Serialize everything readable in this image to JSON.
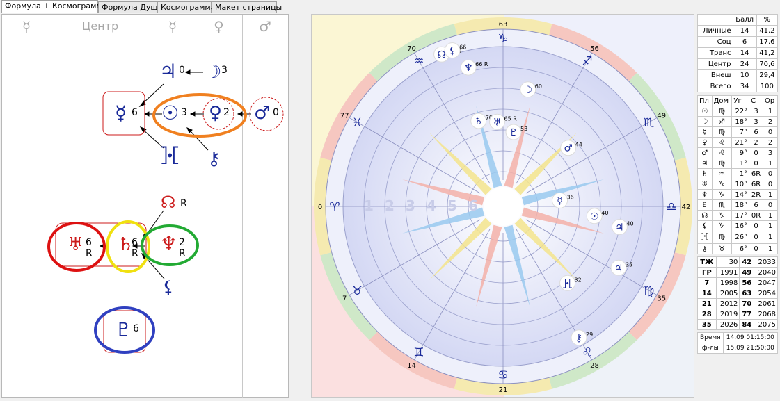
{
  "tabs": [
    {
      "label": "Формула + Космограмма",
      "active": true
    },
    {
      "label": "Формула Души",
      "active": false
    },
    {
      "label": "Космограмма",
      "active": false
    },
    {
      "label": "Макет страницы",
      "active": false
    }
  ],
  "formula": {
    "headers": [
      "☿",
      "Центр",
      "☿",
      "♀",
      "♂"
    ],
    "nodes": {
      "jupiter": {
        "glyph": "♃",
        "num": "0"
      },
      "moon": {
        "glyph": "☽",
        "num": "3"
      },
      "mercury": {
        "glyph": "☿",
        "num": "6"
      },
      "sun": {
        "glyph": "☉",
        "num": "3"
      },
      "venus": {
        "glyph": "♀",
        "num": "2"
      },
      "mars": {
        "glyph": "♂",
        "num": "0"
      },
      "proserpina": {
        "glyph": "⯘"
      },
      "chiron": {
        "glyph": "⚷"
      },
      "node": {
        "glyph": "☊",
        "num": "R"
      },
      "uranus": {
        "glyph": "♅",
        "num": "6",
        "retro": "R"
      },
      "saturn": {
        "glyph": "♄",
        "num": "6",
        "retro": "R"
      },
      "neptune": {
        "glyph": "♆",
        "num": "2",
        "retro": "R"
      },
      "lilith": {
        "glyph": "⚸"
      },
      "pluto": {
        "glyph": "♇",
        "num": "6"
      }
    }
  },
  "chart": {
    "zodiac_signs": [
      "♑",
      "♐",
      "♏",
      "♎",
      "♍",
      "♌",
      "♋",
      "♊",
      "♉",
      "♈",
      "♓",
      "♒"
    ],
    "degree_ticks": [
      "63",
      "56",
      "49",
      "42",
      "35",
      "28",
      "21",
      "14",
      "7",
      "0",
      "77",
      "70"
    ],
    "planets": [
      {
        "glyph": "☊",
        "label": "66 R"
      },
      {
        "glyph": "⚸",
        "label": "66"
      },
      {
        "glyph": "♆",
        "label": "66 R"
      },
      {
        "glyph": "☽",
        "label": "60"
      },
      {
        "glyph": "♄",
        "label": "70 R"
      },
      {
        "glyph": "♅",
        "label": "65 R"
      },
      {
        "glyph": "♇",
        "label": "53"
      },
      {
        "glyph": "♂",
        "label": "44"
      },
      {
        "glyph": "☿",
        "label": "36"
      },
      {
        "glyph": "☉",
        "label": "40"
      },
      {
        "glyph": "♃",
        "label": "40"
      },
      {
        "glyph": "⯘",
        "label": "32"
      },
      {
        "glyph": "♃",
        "label": "35"
      },
      {
        "glyph": "⚷",
        "label": "29"
      }
    ],
    "house_numbers": [
      "1",
      "2",
      "3",
      "4",
      "5",
      "6"
    ]
  },
  "scores": {
    "headers": [
      "",
      "Балл",
      "%"
    ],
    "rows": [
      [
        "Личные",
        "14",
        "41,2"
      ],
      [
        "Соц",
        "6",
        "17,6"
      ],
      [
        "Транс",
        "14",
        "41,2"
      ],
      [
        "Центр",
        "24",
        "70,6"
      ],
      [
        "Внеш",
        "10",
        "29,4"
      ],
      [
        "Всего",
        "34",
        "100"
      ]
    ]
  },
  "planets_table": {
    "headers": [
      "Пл",
      "Дом",
      "Уг",
      "С",
      "Ор"
    ],
    "rows": [
      [
        "☉",
        "♍",
        "22°",
        "3",
        "1"
      ],
      [
        "☽",
        "♐",
        "18°",
        "3",
        "2"
      ],
      [
        "☿",
        "♍",
        "7°",
        "6",
        "0"
      ],
      [
        "♀",
        "♌",
        "21°",
        "2",
        "2"
      ],
      [
        "♂",
        "♌",
        "9°",
        "0",
        "3"
      ],
      [
        "♃",
        "♍",
        "1°",
        "0",
        "1"
      ],
      [
        "♄",
        "♒",
        "1°",
        "6R",
        "0"
      ],
      [
        "♅",
        "♑",
        "10°",
        "6R",
        "0"
      ],
      [
        "♆",
        "♑",
        "14°",
        "2R",
        "1"
      ],
      [
        "♇",
        "♏",
        "18°",
        "6",
        "0"
      ],
      [
        "☊",
        "♑",
        "17°",
        "0R",
        "1"
      ],
      [
        "⚸",
        "♑",
        "16°",
        "0",
        "1"
      ],
      [
        "⯘",
        "♍",
        "26°",
        "0",
        "1"
      ],
      [
        "⚷",
        "♉",
        "6°",
        "0",
        "1"
      ]
    ]
  },
  "years_table": {
    "rows": [
      [
        "ТЖ",
        "30",
        "42",
        "2033"
      ],
      [
        "ГР",
        "1991",
        "49",
        "2040"
      ],
      [
        "7",
        "1998",
        "56",
        "2047"
      ],
      [
        "14",
        "2005",
        "63",
        "2054"
      ],
      [
        "21",
        "2012",
        "70",
        "2061"
      ],
      [
        "28",
        "2019",
        "77",
        "2068"
      ],
      [
        "35",
        "2026",
        "84",
        "2075"
      ]
    ]
  },
  "time_table": {
    "rows": [
      [
        "Время",
        "14.09 01:15:00"
      ],
      [
        "ф-лы",
        "15.09 21:50:00"
      ]
    ]
  },
  "colors": {
    "red": "#cc1b1b",
    "navy": "#1a2a99",
    "orange": "#f08020",
    "yellow": "#f0e010",
    "green": "#22aa33",
    "blue_circle": "#3040c0"
  }
}
